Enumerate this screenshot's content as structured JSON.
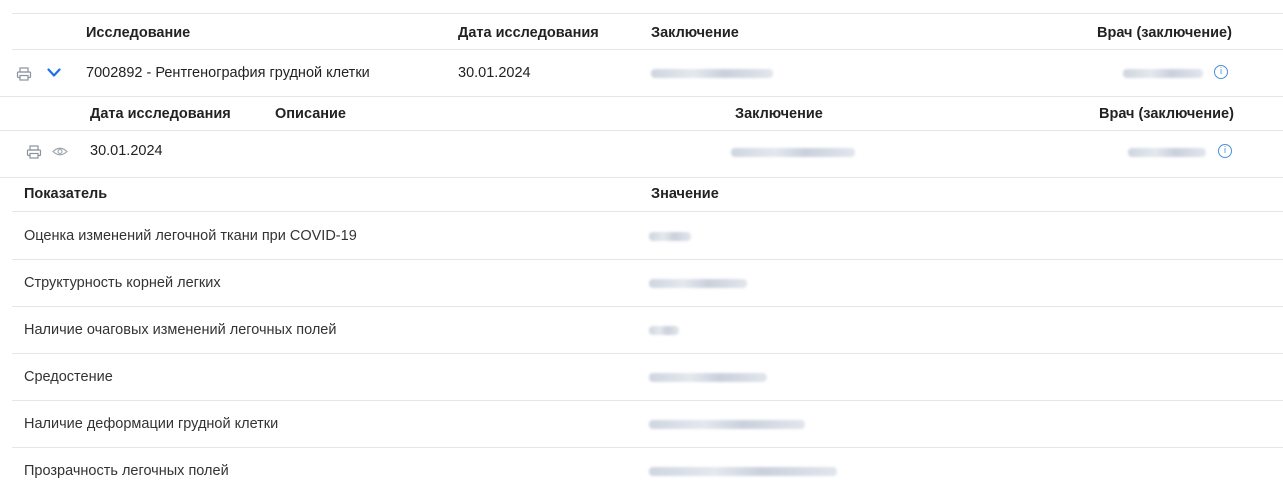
{
  "outer_table": {
    "headers": {
      "study": "Исследование",
      "study_date": "Дата исследования",
      "conclusion": "Заключение",
      "doctor": "Врач (заключение)"
    },
    "row": {
      "study": "7002892 - Рентгенография грудной клетки",
      "date": "30.01.2024"
    }
  },
  "inner_table": {
    "headers": {
      "study_date": "Дата исследования",
      "description": "Описание",
      "conclusion": "Заключение",
      "doctor": "Врач (заключение)"
    },
    "row": {
      "date": "30.01.2024"
    }
  },
  "indicators": {
    "headers": {
      "indicator": "Показатель",
      "value": "Значение"
    },
    "rows": [
      {
        "label": "Оценка изменений легочной ткани при COVID-19"
      },
      {
        "label": "Структурность корней легких"
      },
      {
        "label": "Наличие очаговых изменений легочных полей"
      },
      {
        "label": "Средостение"
      },
      {
        "label": "Наличие деформации грудной клетки"
      },
      {
        "label": "Прозрачность легочных полей"
      }
    ]
  },
  "icons": [
    "print-icon",
    "chevron-down-icon",
    "eye-icon",
    "info-icon"
  ],
  "colors": {
    "accent": "#1a73e8",
    "info": "#4a8fd6",
    "header_bg": "#f5f6f8",
    "divider": "#e6e6e6"
  }
}
